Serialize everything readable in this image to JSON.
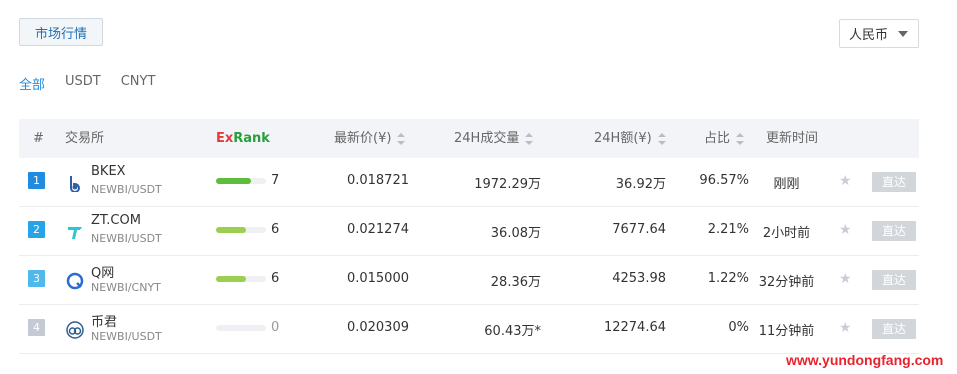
{
  "header": {
    "market_tab": "市场行情",
    "currency_select": "人民币"
  },
  "filters": [
    "全部",
    "USDT",
    "CNYT"
  ],
  "table": {
    "columns": {
      "index": "#",
      "exchange": "交易所",
      "exrank_a": "Ex",
      "exrank_b": "Rank",
      "price": "最新价(¥)",
      "volume": "24H成交量",
      "amount": "24H额(¥)",
      "share": "占比",
      "updated": "更新时间"
    },
    "rows": [
      {
        "rank": "1",
        "name": "BKEX",
        "pair": "NEWBI/USDT",
        "score": "7",
        "score_pct": 0.7,
        "price": "0.018721",
        "volume": "1972.29万",
        "amount": "36.92万",
        "share": "96.57%",
        "updated": "刚刚",
        "action": "直达",
        "badge_color": "#1f8ce0",
        "bar_color": "#5cbd3c"
      },
      {
        "rank": "2",
        "name": "ZT.COM",
        "pair": "NEWBI/USDT",
        "score": "6",
        "score_pct": 0.6,
        "price": "0.021274",
        "volume": "36.08万",
        "amount": "7677.64",
        "share": "2.21%",
        "updated": "2小时前",
        "action": "直达",
        "badge_color": "#27a3e8",
        "bar_color": "#9ccf4f"
      },
      {
        "rank": "3",
        "name": "Q网",
        "pair": "NEWBI/CNYT",
        "score": "6",
        "score_pct": 0.6,
        "price": "0.015000",
        "volume": "28.36万",
        "amount": "4253.98",
        "share": "1.22%",
        "updated": "32分钟前",
        "action": "直达",
        "badge_color": "#4fb9ee",
        "bar_color": "#9ccf4f"
      },
      {
        "rank": "4",
        "name": "币君",
        "pair": "NEWBI/USDT",
        "score": "0",
        "score_pct": 0,
        "price": "0.020309",
        "volume": "60.43万*",
        "amount": "12274.64",
        "share": "0%",
        "updated": "11分钟前",
        "action": "直达",
        "badge_color": "#c4cad3",
        "bar_color": "#9ccf4f"
      }
    ]
  },
  "watermark": "www.yundongfang.com"
}
